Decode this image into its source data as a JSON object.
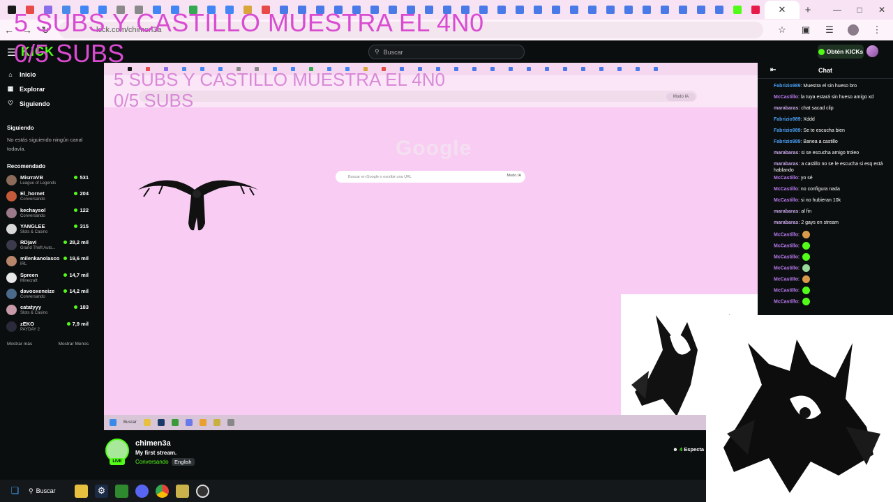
{
  "browser": {
    "url": "kick.com/chimen3a",
    "tab_colors": [
      "#1a1a1a",
      "#e84a4a",
      "#8a6de8",
      "#4a8ae8",
      "#4285f4",
      "#4285f4",
      "#8a8a8a",
      "#8a8a8a",
      "#4285f4",
      "#4285f4",
      "#34a853",
      "#4285f4",
      "#4285f4",
      "#d8a63a",
      "#e84a4a",
      "#4a7ae8",
      "#4a7ae8",
      "#4a7ae8",
      "#4a7ae8",
      "#4a7ae8",
      "#4a7ae8",
      "#4a7ae8",
      "#4a7ae8",
      "#4a7ae8",
      "#4a7ae8",
      "#4a7ae8",
      "#4a7ae8",
      "#4a7ae8",
      "#4a7ae8",
      "#4a7ae8",
      "#4a7ae8",
      "#4a7ae8",
      "#4a7ae8",
      "#4a7ae8",
      "#4a7ae8",
      "#4a7ae8",
      "#4a7ae8",
      "#4a7ae8",
      "#4a7ae8",
      "#4a7ae8",
      "#53fc18",
      "#e81a4a"
    ]
  },
  "overlay": {
    "title": "5 SUBS Y CASTILLO MUESTRA EL 4N0",
    "subs": "0/5 SUBS"
  },
  "header": {
    "logo": "KICK",
    "search_placeholder": "Buscar",
    "kicks_button": "Obtén KICKs"
  },
  "sidebar": {
    "nav": [
      {
        "label": "Inicio",
        "icon": "home-icon"
      },
      {
        "label": "Explorar",
        "icon": "compass-icon"
      },
      {
        "label": "Siguiendo",
        "icon": "heart-icon"
      }
    ],
    "following_heading": "Siguiendo",
    "following_empty": "No estás siguiendo ningún canal todavía.",
    "recommended_heading": "Recomendado",
    "channels": [
      {
        "name": "MisrraVB",
        "category": "League of Legends",
        "viewers": "531",
        "color": "#8c6b5a"
      },
      {
        "name": "El_hornet",
        "category": "Conversando",
        "viewers": "204",
        "color": "#c45a3a"
      },
      {
        "name": "kechaysol",
        "category": "Conversando",
        "viewers": "122",
        "color": "#9a7a8a"
      },
      {
        "name": "YANGLEE",
        "category": "Slots & Casino",
        "viewers": "315",
        "color": "#d8d8d8"
      },
      {
        "name": "RDjavi",
        "category": "Grand Theft Auto...",
        "viewers": "28,2 mil",
        "color": "#3a3a4a"
      },
      {
        "name": "milenkanolasco",
        "category": "IRL",
        "viewers": "19,6 mil",
        "color": "#b8866a"
      },
      {
        "name": "Spreen",
        "category": "Minecraft",
        "viewers": "14,7 mil",
        "color": "#e8e8e8"
      },
      {
        "name": "davooxeneize",
        "category": "Conversando",
        "viewers": "14,2 mil",
        "color": "#4a6a8a"
      },
      {
        "name": "catatyyy",
        "category": "Slots & Casino",
        "viewers": "183",
        "color": "#c89aa8"
      },
      {
        "name": "zEKO",
        "category": "PAYDAY 2",
        "viewers": "7,9 mil",
        "color": "#2a2a3a"
      }
    ],
    "show_more": "Mostrar más",
    "show_less": "Mostrar Menos"
  },
  "stream_capture": {
    "title": "5 SUBS Y CASTILLO MUESTRA EL 4N0",
    "subs": "0/5 SUBS",
    "google_logo": "Google",
    "search_placeholder": "Buscar en Google o escribir una URL",
    "modo_ia": "Modo IA",
    "taskbar_search": "Buscar"
  },
  "chat": {
    "title": "Chat",
    "messages": [
      {
        "user": "Fabrizio989",
        "text": "Muestra el sin hueso bro",
        "color": "#4a9ef0"
      },
      {
        "user": "McCastillo",
        "text": "la tuya estará sin hueso amigo xd",
        "color": "#b97af0"
      },
      {
        "user": "marabaras",
        "text": "chat sacad clip",
        "color": "#c9a6e8"
      },
      {
        "user": "Fabrizio989",
        "text": "Xddd",
        "color": "#4a9ef0"
      },
      {
        "user": "Fabrizio989",
        "text": "Se te escucha bien",
        "color": "#4a9ef0"
      },
      {
        "user": "Fabrizio989",
        "text": "Banea a castillo",
        "color": "#4a9ef0"
      },
      {
        "user": "marabaras",
        "text": "si se escucha amigo troleo",
        "color": "#c9a6e8"
      },
      {
        "user": "marabaras",
        "text": "a castillo no se le escucha si esq está hablando",
        "color": "#c9a6e8"
      },
      {
        "user": "McCastillo",
        "text": "yo sé",
        "color": "#b97af0"
      },
      {
        "user": "McCastillo",
        "text": "no configura nada",
        "color": "#b97af0"
      },
      {
        "user": "McCastillo",
        "text": "si no hubieran 10k",
        "color": "#b97af0"
      },
      {
        "user": "marabaras",
        "text": "al fin",
        "color": "#c9a6e8"
      },
      {
        "user": "marabaras",
        "text": "2 gays en stream",
        "color": "#c9a6e8"
      },
      {
        "user": "McCastillo",
        "text": "",
        "color": "#b97af0",
        "emote": "#d89a4a"
      },
      {
        "user": "McCastillo",
        "text": "",
        "color": "#b97af0",
        "emote": "#53fc18"
      },
      {
        "user": "McCastillo",
        "text": "",
        "color": "#b97af0",
        "emote": "#53fc18"
      },
      {
        "user": "McCastillo",
        "text": "",
        "color": "#b97af0",
        "emote": "#9ad89a"
      },
      {
        "user": "McCastillo",
        "text": "",
        "color": "#b97af0",
        "emote": "#d89a4a"
      },
      {
        "user": "McCastillo",
        "text": "",
        "color": "#b97af0",
        "emote": "#53fc18"
      },
      {
        "user": "McCastillo",
        "text": "",
        "color": "#b97af0",
        "emote": "#53fc18"
      }
    ]
  },
  "stream_info": {
    "channel": "chimen3a",
    "title": "My first stream.",
    "category": "Conversando",
    "language": "English",
    "live": "LIVE",
    "viewers_count": "4",
    "viewers_label": "Especta"
  },
  "taskbar": {
    "search_label": "Buscar"
  },
  "colors": {
    "kick_green": "#53fc18",
    "overlay_pink": "#d94cd1",
    "stream_bg": "#f9ccf4"
  }
}
